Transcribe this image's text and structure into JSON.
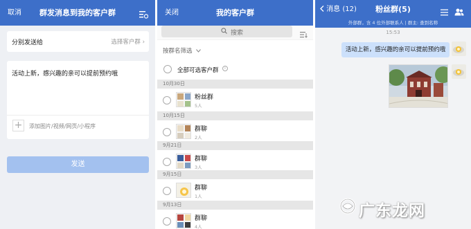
{
  "panel1": {
    "header": {
      "left_button": "取消",
      "title": "群发消息到我的客户群"
    },
    "send_to": {
      "label": "分别发送给",
      "value": "选择客户群",
      "chevron": "›"
    },
    "message": {
      "text": "活动上新，感兴趣的亲可以提前预约哦",
      "add_icon": "+",
      "add_label": "添加图片/视频/网页/小程序"
    },
    "send_button": "发送"
  },
  "panel2": {
    "header": {
      "left_button": "关闭",
      "title": "我的客户群"
    },
    "search": {
      "placeholder": "搜索",
      "icon": "search-icon"
    },
    "filter_label": "按群名筛选",
    "select_all": {
      "label": "全部可选客户群",
      "info": "i"
    },
    "groups": [
      {
        "date": "10月30日",
        "name": "粉丝群",
        "count": "5人"
      },
      {
        "date": "10月15日",
        "name": "群聊",
        "count": "2人"
      },
      {
        "date": "9月21日",
        "name": "群聊",
        "count": "3人"
      },
      {
        "date": "9月15日",
        "name": "群聊",
        "count": "1人"
      },
      {
        "date": "9月13日",
        "name": "群聊",
        "count": "4人"
      }
    ]
  },
  "panel3": {
    "header": {
      "back_label": "消息 (12)",
      "title": "粉丝群(5)"
    },
    "subtitle": "外部群，含 4 位外部联系人 | 群主: 查到名称",
    "time": "15:53",
    "message_text": "活动上新，感兴趣的亲可以提前预约哦"
  },
  "watermark": "广东龙网",
  "colors": {
    "header_blue": "#3d6fc9",
    "send_button": "#a3c1ef",
    "bubble": "#cce0fb"
  }
}
